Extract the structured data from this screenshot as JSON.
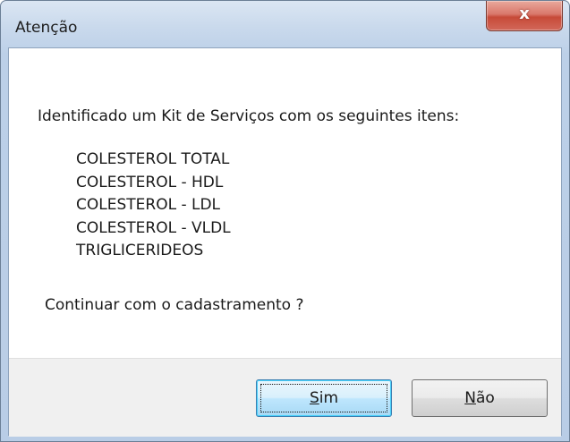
{
  "window": {
    "title": "Atenção",
    "close_glyph": "x"
  },
  "dialog": {
    "message": "Identificado um Kit de Serviços com os seguintes itens:",
    "items": [
      "COLESTEROL TOTAL",
      "COLESTEROL - HDL",
      "COLESTEROL - LDL",
      "COLESTEROL - VLDL",
      "TRIGLICERIDEOS"
    ],
    "question": "Continuar com o cadastramento ?"
  },
  "buttons": {
    "yes_mnemonic": "S",
    "yes_rest": "im",
    "no_mnemonic": "N",
    "no_rest": "ão"
  }
}
